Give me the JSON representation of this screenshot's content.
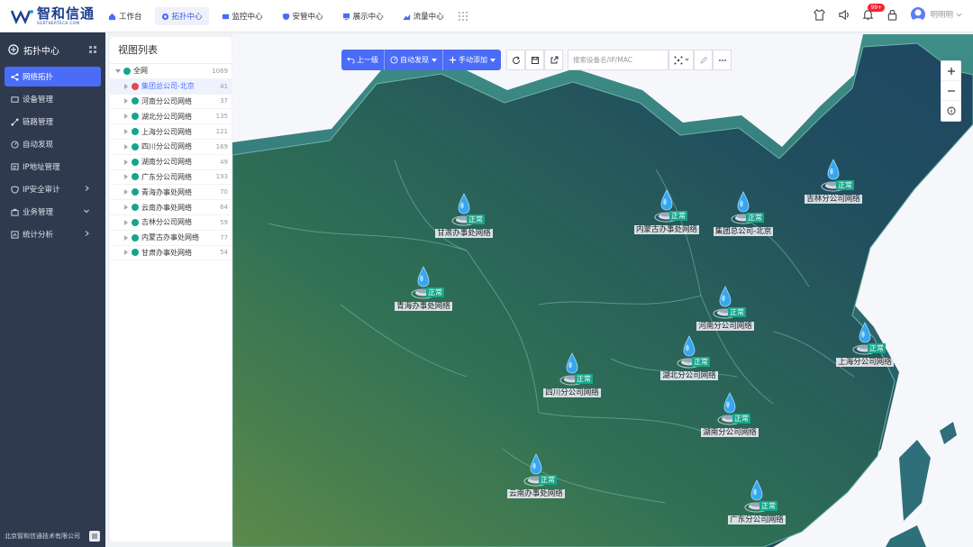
{
  "brand": {
    "name": "智和信通",
    "tagline": "SGRTHERTECH.COM"
  },
  "top_tabs": [
    {
      "label": "工作台",
      "icon": "home-icon"
    },
    {
      "label": "拓扑中心",
      "icon": "topology-icon",
      "active": true
    },
    {
      "label": "监控中心",
      "icon": "monitor-icon"
    },
    {
      "label": "安管中心",
      "icon": "shield-icon"
    },
    {
      "label": "展示中心",
      "icon": "display-icon"
    },
    {
      "label": "流量中心",
      "icon": "flow-icon"
    }
  ],
  "header_right": {
    "notification_count": "99+",
    "username": "明明明"
  },
  "sidebar": {
    "title": "拓扑中心",
    "items": [
      {
        "label": "网络拓扑",
        "icon": "network-icon",
        "active": true
      },
      {
        "label": "设备管理",
        "icon": "device-icon"
      },
      {
        "label": "链路管理",
        "icon": "link-icon"
      },
      {
        "label": "自动发现",
        "icon": "discover-icon"
      },
      {
        "label": "IP地址管理",
        "icon": "ip-icon"
      },
      {
        "label": "IP安全审计",
        "icon": "audit-icon",
        "arrow": ">"
      },
      {
        "label": "业务管理",
        "icon": "business-icon",
        "arrow": "v"
      },
      {
        "label": "统计分析",
        "icon": "stats-icon",
        "arrow": ">"
      }
    ],
    "footer": "北京智和信通技术有限公司"
  },
  "view_list": {
    "title": "视图列表",
    "root": {
      "label": "全网",
      "count": "1069"
    },
    "items": [
      {
        "label": "集团总公司-北京",
        "count": "41",
        "color": "#e5484d",
        "selected": true
      },
      {
        "label": "河南分公司网络",
        "count": "37",
        "color": "#16a58a"
      },
      {
        "label": "湖北分公司网络",
        "count": "135",
        "color": "#16a58a"
      },
      {
        "label": "上海分公司网络",
        "count": "121",
        "color": "#16a58a"
      },
      {
        "label": "四川分公司网络",
        "count": "169",
        "color": "#16a58a"
      },
      {
        "label": "湖南分公司网络",
        "count": "49",
        "color": "#16a58a"
      },
      {
        "label": "广东分公司网络",
        "count": "193",
        "color": "#16a58a"
      },
      {
        "label": "青海办事处网络",
        "count": "70",
        "color": "#16a58a"
      },
      {
        "label": "云南办事处网络",
        "count": "64",
        "color": "#16a58a"
      },
      {
        "label": "吉林分公司网络",
        "count": "59",
        "color": "#16a58a"
      },
      {
        "label": "内蒙古办事处网络",
        "count": "77",
        "color": "#16a58a"
      },
      {
        "label": "甘肃办事处网络",
        "count": "54",
        "color": "#16a58a"
      }
    ]
  },
  "toolbar": {
    "up_label": "上一级",
    "auto_discover_label": "自动发现",
    "manual_add_label": "手动添加",
    "search_placeholder": "搜索设备名/IP/MAC"
  },
  "map_nodes": [
    {
      "label": "甘肃办事处网络",
      "status": "正常"
    },
    {
      "label": "内蒙古办事处网络",
      "status": "正常"
    },
    {
      "label": "集团总公司-北京",
      "status": "正常"
    },
    {
      "label": "吉林分公司网络",
      "status": "正常"
    },
    {
      "label": "青海办事处网络",
      "status": "正常"
    },
    {
      "label": "河南分公司网络",
      "status": "正常"
    },
    {
      "label": "湖北分公司网络",
      "status": "正常"
    },
    {
      "label": "四川分公司网络",
      "status": "正常"
    },
    {
      "label": "上海分公司网络",
      "status": "正常"
    },
    {
      "label": "湖南分公司网络",
      "status": "正常"
    },
    {
      "label": "云南办事处网络",
      "status": "正常"
    },
    {
      "label": "广东分公司网络",
      "status": "正常"
    }
  ],
  "colors": {
    "accent": "#4a6cf7",
    "sidebar_bg": "#2f3a4f",
    "status_normal": "#16a58a",
    "alert": "#e5484d"
  }
}
